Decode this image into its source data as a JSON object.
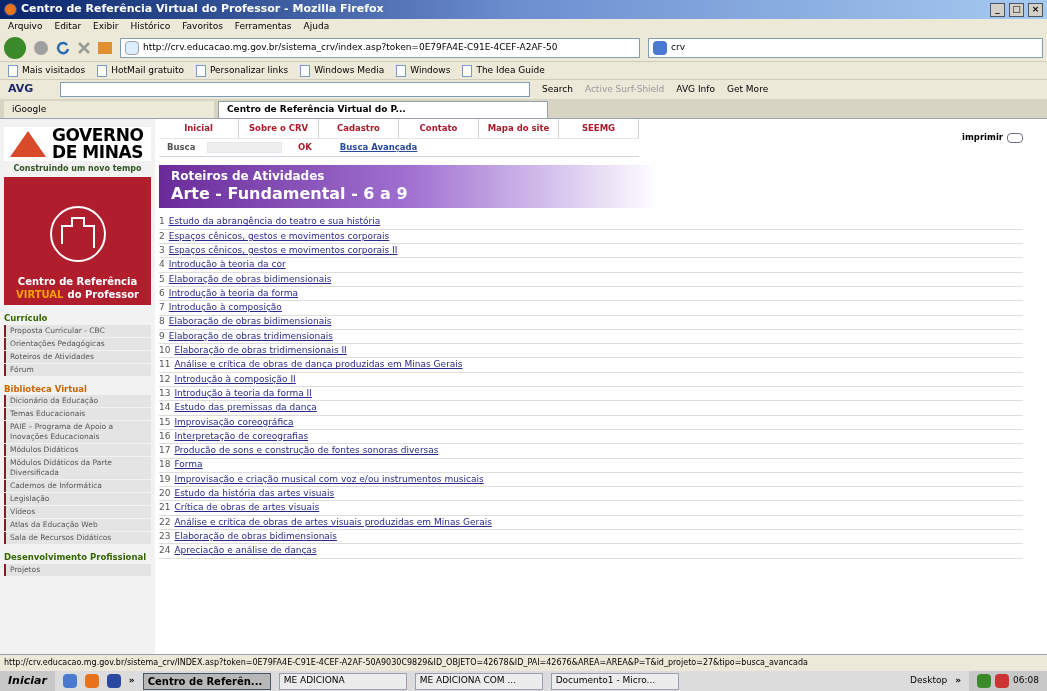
{
  "window": {
    "title": "Centro de Referência Virtual do Professor - Mozilla Firefox",
    "controls": [
      "_",
      "□",
      "×"
    ]
  },
  "menu": [
    "Arquivo",
    "Editar",
    "Exibir",
    "Histórico",
    "Favoritos",
    "Ferramentas",
    "Ajuda"
  ],
  "nav": {
    "url": "http://crv.educacao.mg.gov.br/sistema_crv/index.asp?token=0E79FA4E-C91E-4CEF-A2AF-50",
    "search_value": "crv"
  },
  "bookmarks": [
    "Mais visitados",
    "HotMail gratuito",
    "Personalizar links",
    "Windows Media",
    "Windows",
    "The Idea Guide"
  ],
  "avg_toolbar": {
    "brand": "AVG",
    "items": [
      "Search",
      "Active Surf-Shield",
      "AVG Info",
      "Get More"
    ]
  },
  "tabs": [
    {
      "label": "iGoogle",
      "selected": false
    },
    {
      "label": "Centro de Referência Virtual do P...",
      "selected": true
    }
  ],
  "site": {
    "logo": {
      "line1": "GOVERNO",
      "line2": "DE MINAS",
      "slogan": "Construindo um novo tempo"
    },
    "crv_logo": {
      "line1": "Centro de Referência",
      "highlight": "VIRTUAL",
      "rest": "do Professor"
    },
    "top_links": [
      "Inicial",
      "Sobre o CRV",
      "Cadastro",
      "Contato",
      "Mapa do site",
      "SEEMG"
    ],
    "print_label": "imprimir",
    "search": {
      "label": "Busca",
      "ok": "OK",
      "advanced": "Busca Avançada"
    },
    "sidebar": [
      {
        "heading": "Currículo",
        "color": "#336600",
        "items": [
          "Proposta Curricular - CBC",
          "Orientações Pedagógicas",
          "Roteiros de Atividades",
          "Fórum"
        ]
      },
      {
        "heading": "Biblioteca Virtual",
        "color": "#cc6600",
        "items": [
          "Dicionário da Educação",
          "Temas Educacionais",
          "PAIE – Programa de Apoio a Inovações Educacionais",
          "Módulos Didáticos",
          "Módulos Didáticos da Parte Diversificada",
          "Cademos de Informática",
          "Legislação",
          "Vídeos",
          "Atlas da Educação Web",
          "Sala de Recursos Didáticos"
        ]
      },
      {
        "heading": "Desenvolvimento Profissional",
        "color": "#336600",
        "items": [
          "Projetos"
        ]
      }
    ],
    "banner": {
      "title": "Roteiros de Atividades",
      "subtitle": "Arte - Fundamental - 6 a 9"
    },
    "activities": [
      {
        "number": "1",
        "title": "Estudo da abrangência do teatro e sua história"
      },
      {
        "number": "2",
        "title": "Espaços cênicos, gestos e movimentos corporais"
      },
      {
        "number": "3",
        "title": "Espaços cênicos, gestos e movimentos corporais II"
      },
      {
        "number": "4",
        "title": "Introdução à teoria da cor"
      },
      {
        "number": "5",
        "title": "Elaboração de obras bidimensionais"
      },
      {
        "number": "6",
        "title": "Introdução à teoria da forma"
      },
      {
        "number": "7",
        "title": "Introdução à composição"
      },
      {
        "number": "8",
        "title": "Elaboração de obras bidimensionais"
      },
      {
        "number": "9",
        "title": "Elaboração de obras tridimensionais"
      },
      {
        "number": "10",
        "title": "Elaboração de obras tridimensionais II"
      },
      {
        "number": "11",
        "title": "Análise e crítica de obras de dança produzidas em Minas Gerais"
      },
      {
        "number": "12",
        "title": "Introdução à composição II"
      },
      {
        "number": "13",
        "title": "Introdução à teoria da forma II"
      },
      {
        "number": "14",
        "title": "Estudo das premissas da dança"
      },
      {
        "number": "15",
        "title": "Improvisação coreográfica"
      },
      {
        "number": "16",
        "title": "Interpretação de coreografias"
      },
      {
        "number": "17",
        "title": "Producão de sons e construção de fontes sonoras diversas"
      },
      {
        "number": "18",
        "title": "Forma"
      },
      {
        "number": "19",
        "title": "Improvisação e criação musical com voz e/ou instrumentos musicais"
      },
      {
        "number": "20",
        "title": "Estudo da história das artes visuais"
      },
      {
        "number": "21",
        "title": "Crítica de obras de artes visuais"
      },
      {
        "number": "22",
        "title": "Análise e crítica de obras de artes visuais produzidas em Minas Gerais"
      },
      {
        "number": "23",
        "title": "Elaboração de obras bidimensionais"
      },
      {
        "number": "24",
        "title": "Apreciação e análise de danças"
      }
    ]
  },
  "status_bar": "http://crv.educacao.mg.gov.br/sistema_crv/INDEX.asp?token=0E79FA4E-C91E-4CEF-A2AF-50A9030C9829&ID_OBJETO=42678&ID_PAI=42676&AREA=AREA&P=T&id_projeto=27&tipo=busca_avancada",
  "taskbar": {
    "start": "Iniciar",
    "chevron": "»",
    "items": [
      {
        "label": "Centro de Referên...",
        "selected": true
      },
      {
        "label": "ME ADICIONA",
        "selected": false
      },
      {
        "label": "ME ADICIONA COM ...",
        "selected": false
      },
      {
        "label": "Documento1 - Micro...",
        "selected": false
      }
    ],
    "desktop": "Desktop",
    "tray_chevron": "»",
    "clock": "06:08"
  }
}
